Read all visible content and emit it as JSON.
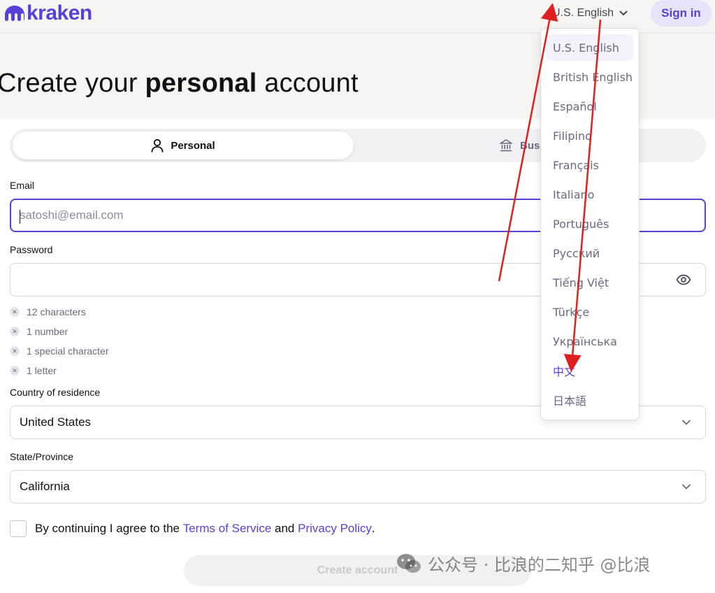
{
  "header": {
    "logo_text": "kraken",
    "language_selected": "U.S. English",
    "sign_in_label": "Sign in",
    "brand_color": "#5741d9"
  },
  "page": {
    "title_pre": "Create your ",
    "title_bold": "personal",
    "title_post": " account"
  },
  "account_tabs": {
    "personal_label": "Personal",
    "business_label": "Bus"
  },
  "form": {
    "email_label": "Email",
    "email_placeholder": "satoshi@email.com",
    "password_label": "Password",
    "password_rules": [
      "12 characters",
      "1 number",
      "1 special character",
      "1 letter"
    ],
    "country_label": "Country of residence",
    "country_value": "United States",
    "state_label": "State/Province",
    "state_value": "California",
    "agree_pre": "By continuing I agree to the ",
    "terms_label": "Terms of Service",
    "agree_mid": " and ",
    "privacy_label": "Privacy Policy",
    "agree_post": ".",
    "create_button_label": "Create account"
  },
  "language_menu": {
    "options": [
      "U.S. English",
      "British English",
      "Español",
      "Filipino",
      "Français",
      "Italiano",
      "Português",
      "Русский",
      "Tiếng Việt",
      "Türkçe",
      "Українська",
      "中文",
      "日本語"
    ],
    "selected": "U.S. English",
    "highlighted": "中文"
  },
  "watermark": {
    "text": "公众号 · 比浪的二知乎 @比浪"
  }
}
